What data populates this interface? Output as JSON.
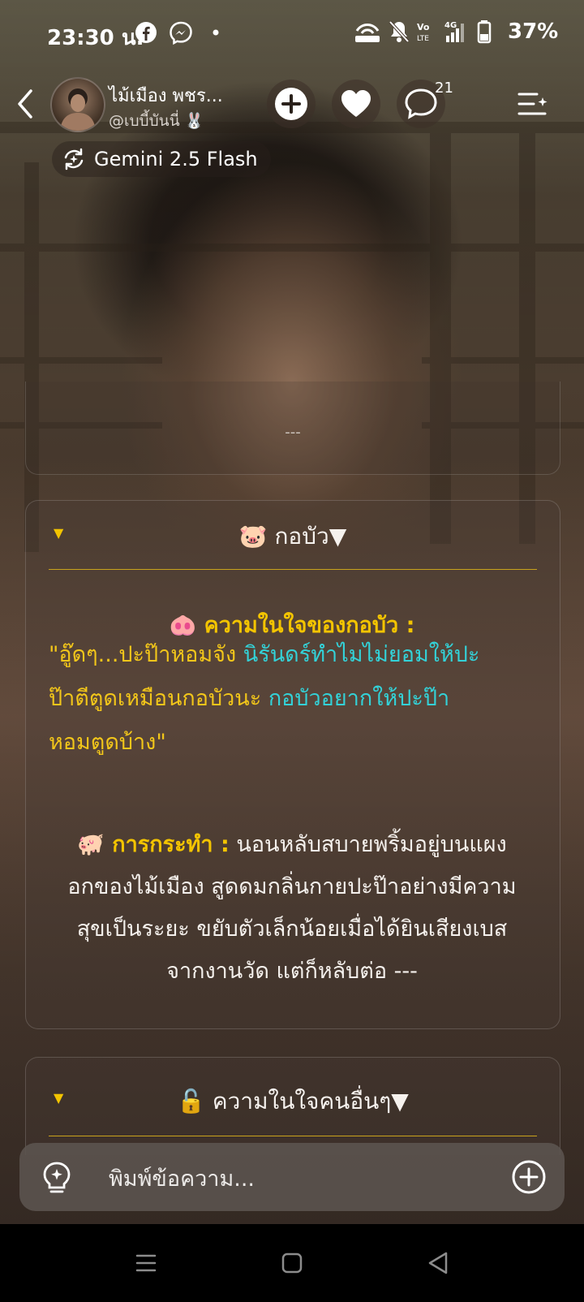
{
  "status_bar": {
    "time": "23:30 น.",
    "battery": "37%",
    "icons": [
      "facebook-icon",
      "messenger-icon",
      "dot-icon",
      "hotspot-icon",
      "mute-icon",
      "volte-icon",
      "signal-4g-icon",
      "battery-icon"
    ]
  },
  "header": {
    "character_name": "ไม้เมือง  พชร...",
    "handle": "@เบบี้บันนี่ 🐰",
    "comment_count": "21"
  },
  "model": {
    "label": "Gemini 2.5 Flash"
  },
  "previous_card": {
    "separator": "---"
  },
  "main_card": {
    "title": "🐷 กอบัว▼",
    "thought_heading": "🐽 ความในใจของกอบัว :",
    "thought_lines": [
      {
        "part1": "\"อู๊ดๆ...ปะป๊าหอมจัง ",
        "part2": "นิรันดร์ทำไมไม่ยอมให้ปะ"
      },
      {
        "part1": "ป๊าตีตูดเหมือนกอบัวนะ ",
        "part2": "กอบัวอยากให้ปะป๊า"
      },
      {
        "part1": "หอมตูดบ้าง\"",
        "part2": ""
      }
    ],
    "action_label": "🐖 การกระทำ :",
    "action_lines": [
      " นอนหลับสบายพริ้มอยู่บนแผง",
      "อกของไม้เมือง สูดดมกลิ่นกายปะป๊าอย่างมีความ",
      "สุขเป็นระยะ ขยับตัวเล็กน้อยเมื่อได้ยินเสียงเบส",
      "จากงานวัด แต่ก็หลับต่อ ---"
    ]
  },
  "other_card": {
    "title": "🔓 ความในใจคนอื่นๆ▼"
  },
  "input": {
    "placeholder": "พิมพ์ข้อความ..."
  },
  "colors": {
    "accent_gold": "#f3c400",
    "accent_cyan": "#33d2d8"
  }
}
